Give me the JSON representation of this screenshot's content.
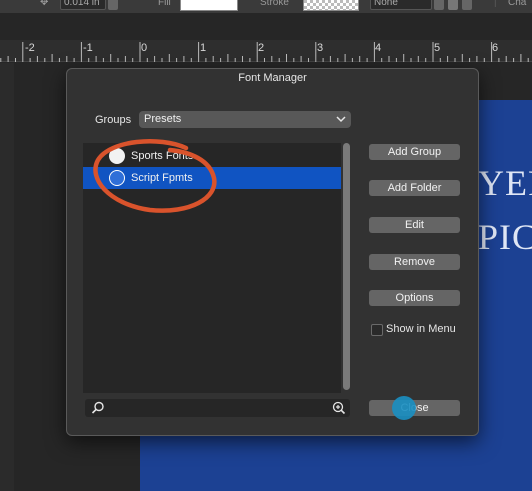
{
  "toolbar": {
    "size_value": "0.014 in",
    "fill_label": "Fill",
    "stroke_label": "Stroke",
    "stroke_style_value": "None",
    "cut_off_label": "Cha"
  },
  "ruler": {
    "labels": [
      "-2",
      "-1",
      "0",
      "1",
      "2",
      "3",
      "4",
      "5",
      "6"
    ]
  },
  "document": {
    "line1": "YER",
    "line2": "PIC"
  },
  "dialog": {
    "title": "Font Manager",
    "groups_label": "Groups",
    "groups_selected": "Presets",
    "list": [
      {
        "label": "Sports Fonts",
        "selected": false
      },
      {
        "label": "Script Fpmts",
        "selected": true
      }
    ],
    "buttons": {
      "add_group": "Add Group",
      "add_folder": "Add Folder",
      "edit": "Edit",
      "remove": "Remove",
      "options": "Options",
      "close": "Close"
    },
    "show_in_menu_label": "Show in Menu",
    "search_value": ""
  },
  "colors": {
    "selection": "#1054c2",
    "annotation": "#d9532c",
    "canvas": "#1c4193"
  }
}
